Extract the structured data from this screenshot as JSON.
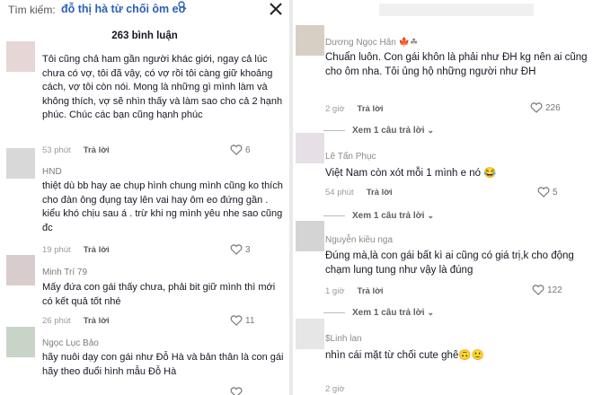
{
  "left": {
    "search_label": "Tìm kiếm:",
    "search_query": "đỗ thị hà từ chối ôm eo",
    "comment_count": "263 bình luận",
    "comments": [
      {
        "name": "",
        "text": "Tôi cũng chả ham gần người khác giới, ngay cả lúc chưa có vợ, tôi đã vậy, có vợ rồi tôi càng giữ khoảng cách, vợ tôi còn nói. Mong là những gì mình làm và không thích, vợ sẽ nhìn thấy và làm sao cho cả 2 hạnh phúc. Chúc các bạn cũng hạnh phúc",
        "time": "53 phút",
        "reply": "Trả lời",
        "likes": "6",
        "avatar_color": "#e6d6d6"
      },
      {
        "name": "HND",
        "text": "thiệt dù bb hay ae chụp hình chung mình cũng ko thích cho đàn ông đụng tay lên vai hay ôm eo đứng gần . kiểu khó chịu sau á . trừ khi ng mình yêu nhe sao cũng đc",
        "time": "19 phút",
        "reply": "Trả lời",
        "likes": "3",
        "avatar_color": "#d8d8d8"
      },
      {
        "name": "Minh Trí 79",
        "text": "Mấy đứa con gái thấy chưa, phải bit giữ mình thì mới có kết quả tốt nhé",
        "time": "26 phút",
        "reply": "Trả lời",
        "likes": "11",
        "avatar_color": "#d9cccc"
      },
      {
        "name": "Ngọc Lục Bảo",
        "text": "hãy nuôi dạy con gái như Đỗ Hà và bản thân là con gái hãy theo đuổi hình mẫu Đỗ Hà",
        "time": "",
        "reply": "",
        "likes": "",
        "avatar_color": "#c8d4c8"
      }
    ]
  },
  "right": {
    "comments": [
      {
        "name": "Dương Ngọc Hân",
        "name_suffix": "🍁☘",
        "text": "Chuẩn luôn. Con gái khôn là phải như ĐH kg nên ai cũng cho ôm nha. Tôi ủng hộ những người như ĐH",
        "time": "2 giờ",
        "reply": "Trả lời",
        "likes": "226",
        "view_more": "Xem 1 câu trả lời",
        "avatar_color": "#d7cfc4"
      },
      {
        "name": "Lê Tấn Phục",
        "name_suffix": "",
        "text": "Việt Nam còn xót mỗi 1 mình e nó 😂",
        "time": "54 phút",
        "reply": "Trả lời",
        "likes": "5",
        "view_more": "Xem 1 câu trả lời",
        "avatar_color": "#e6e0e6"
      },
      {
        "name": "Nguyễn kiều nga",
        "name_suffix": "",
        "text": "Đúng mà,là con gái bất kì ai cũng có giá trị,k cho động chạm lung tung như vậy là đúng",
        "time": "1 giờ",
        "reply": "Trả lời",
        "likes": "122",
        "view_more": "Xem 1 câu trả lời",
        "avatar_color": "#d4d4d4"
      },
      {
        "name": "$Linh lan",
        "name_suffix": "",
        "text": "nhìn cái mặt từ chối cute ghê🙃🙂",
        "time": "2 giờ",
        "reply": "",
        "likes": "",
        "view_more": "",
        "avatar_color": "#e6e6e6"
      }
    ]
  },
  "icons": {
    "heart": "heart-icon",
    "close": "close-icon",
    "search": "search-icon"
  }
}
